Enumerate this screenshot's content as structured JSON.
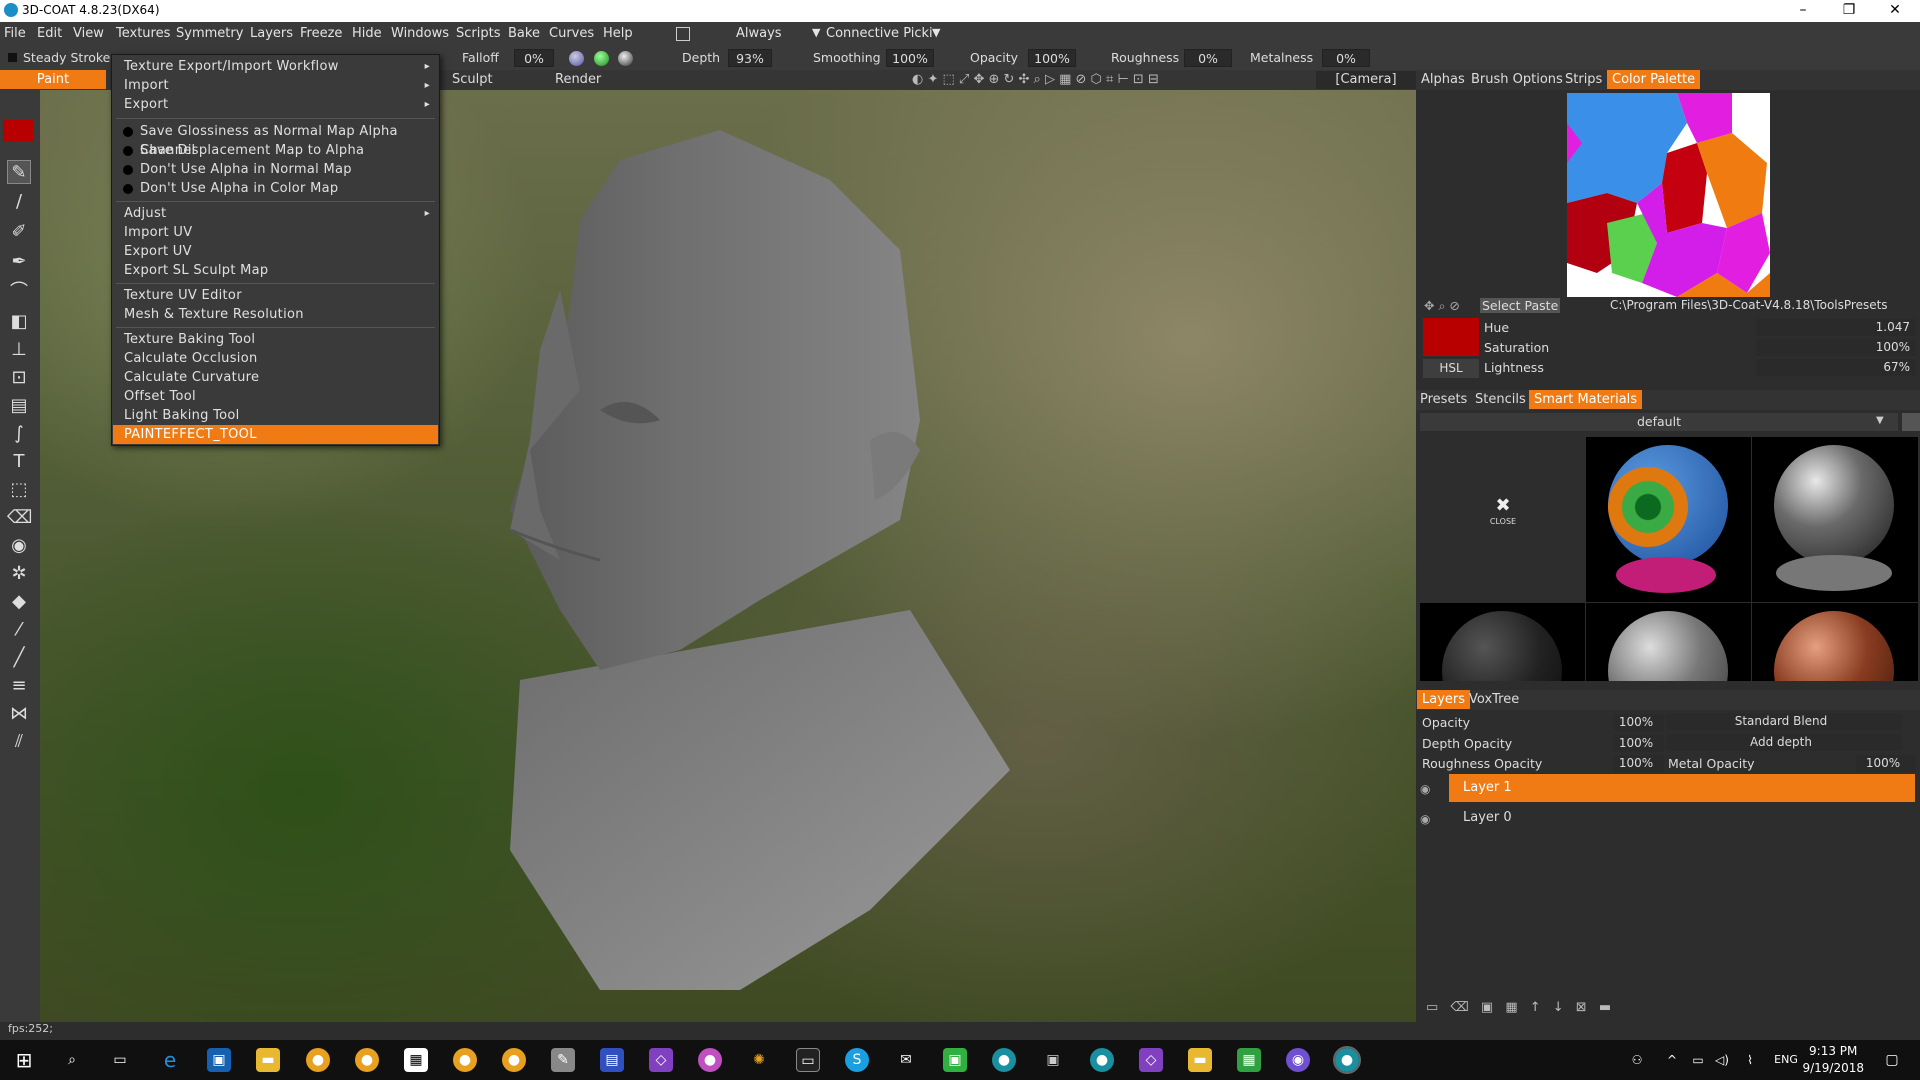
{
  "title": "3D-COAT 4.8.23(DX64)",
  "window_controls": {
    "minimize": "–",
    "maximize": "❐",
    "close": "✕"
  },
  "menubar": [
    "File",
    "Edit",
    "View",
    "Textures",
    "Symmetry",
    "Layers",
    "Freeze",
    "Hide",
    "Windows",
    "Scripts",
    "Bake",
    "Curves",
    "Help"
  ],
  "menubar_extra": {
    "always": "Always",
    "connective": "Connective Picki"
  },
  "options": {
    "steady_stroke": "Steady Stroke",
    "falloff_label": "Falloff",
    "falloff_value": "0%",
    "depth_label": "Depth",
    "depth_value": "93%",
    "smoothing_label": "Smoothing",
    "smoothing_value": "100%",
    "opacity_label": "Opacity",
    "opacity_value": "100%",
    "roughness_label": "Roughness",
    "roughness_value": "0%",
    "metalness_label": "Metalness",
    "metalness_value": "0%"
  },
  "rooms": {
    "paint": "Paint",
    "sculpt": "Sculpt",
    "render": "Render",
    "camera": "[Camera]"
  },
  "menu": {
    "items": [
      {
        "label": "Texture Export/Import Workflow",
        "sub": true
      },
      {
        "label": "Import",
        "sub": true
      },
      {
        "label": "Export",
        "sub": true
      },
      {
        "label": "Save Glossiness as Normal Map Alpha Channel",
        "dot": true
      },
      {
        "label": "Save Displacement Map to Alpha",
        "dot": true
      },
      {
        "label": "Don't Use Alpha in Normal Map",
        "dot": true
      },
      {
        "label": "Don't Use Alpha in Color Map",
        "dot": true
      },
      {
        "label": "Adjust",
        "sub": true
      },
      {
        "label": "Import UV"
      },
      {
        "label": "Export UV"
      },
      {
        "label": "Export SL Sculpt Map"
      },
      {
        "label": "Texture UV Editor"
      },
      {
        "label": "Mesh & Texture Resolution"
      },
      {
        "label": "Texture Baking Tool"
      },
      {
        "label": "Calculate Occlusion"
      },
      {
        "label": "Calculate Curvature"
      },
      {
        "label": "Offset Tool"
      },
      {
        "label": "Light Baking Tool"
      },
      {
        "label": "PAINTEFFECT_TOOL",
        "selected": true
      }
    ],
    "arrow": "▸"
  },
  "right_tabs1": [
    "Alphas",
    "Brush Options",
    "Strips",
    "Color Palette"
  ],
  "palette": {
    "select_paste": "Select Paste",
    "path": "C:\\Program Files\\3D-Coat-V4.8.18\\ToolsPresets",
    "hue_label": "Hue",
    "hue_value": "1.047",
    "sat_label": "Saturation",
    "sat_value": "100%",
    "light_label": "Lightness",
    "light_value": "67%",
    "hsl": "HSL",
    "current_color": "#b80000"
  },
  "right_tabs2": [
    "Presets",
    "Stencils",
    "Smart Materials"
  ],
  "materials": {
    "preset": "default",
    "close": "CLOSE"
  },
  "right_tabs3": [
    "Layers",
    "VoxTree"
  ],
  "layers_panel": {
    "opacity_label": "Opacity",
    "opacity_value": "100%",
    "blend": "Standard Blend",
    "depth_label": "Depth Opacity",
    "depth_value": "100%",
    "add_depth": "Add depth",
    "rough_label": "Roughness Opacity",
    "rough_value": "100%",
    "metal_label": "Metal Opacity",
    "metal_value": "100%",
    "layers": [
      {
        "name": "Layer 1",
        "active": true
      },
      {
        "name": "Layer 0",
        "active": false
      }
    ]
  },
  "status": {
    "fps": "fps:252;"
  },
  "taskbar": {
    "time": "9:13 PM",
    "date": "9/19/2018",
    "lang": "ENG"
  },
  "colors": {
    "accent": "#f07b14"
  }
}
